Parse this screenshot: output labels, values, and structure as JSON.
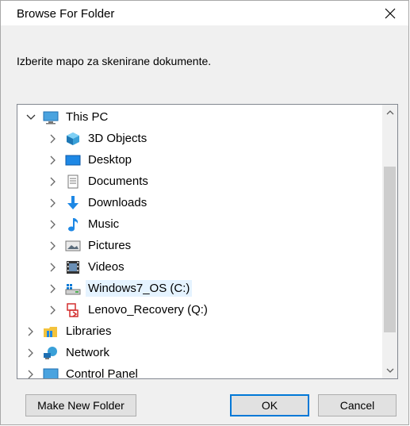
{
  "window": {
    "title": "Browse For Folder"
  },
  "instruction": "Izberite mapo za skenirane dokumente.",
  "tree": {
    "items": [
      {
        "label": "This PC",
        "icon": "computer-icon",
        "level": 0,
        "expanded": true
      },
      {
        "label": "3D Objects",
        "icon": "3d-objects-icon",
        "level": 1
      },
      {
        "label": "Desktop",
        "icon": "desktop-icon",
        "level": 1
      },
      {
        "label": "Documents",
        "icon": "documents-icon",
        "level": 1
      },
      {
        "label": "Downloads",
        "icon": "downloads-icon",
        "level": 1
      },
      {
        "label": "Music",
        "icon": "music-icon",
        "level": 1
      },
      {
        "label": "Pictures",
        "icon": "pictures-icon",
        "level": 1
      },
      {
        "label": "Videos",
        "icon": "videos-icon",
        "level": 1
      },
      {
        "label": "Windows7_OS (C:)",
        "icon": "drive-icon",
        "level": 1,
        "selected": true
      },
      {
        "label": "Lenovo_Recovery (Q:)",
        "icon": "recovery-drive-icon",
        "level": 1
      },
      {
        "label": "Libraries",
        "icon": "libraries-icon",
        "level": 0
      },
      {
        "label": "Network",
        "icon": "network-icon",
        "level": 0
      },
      {
        "label": "Control Panel",
        "icon": "control-panel-icon",
        "level": 0
      }
    ]
  },
  "buttons": {
    "new_folder": "Make New Folder",
    "ok": "OK",
    "cancel": "Cancel"
  },
  "colors": {
    "selection": "#e5f3ff",
    "accent": "#0078d7",
    "dialog_bg": "#f0f0f0"
  }
}
